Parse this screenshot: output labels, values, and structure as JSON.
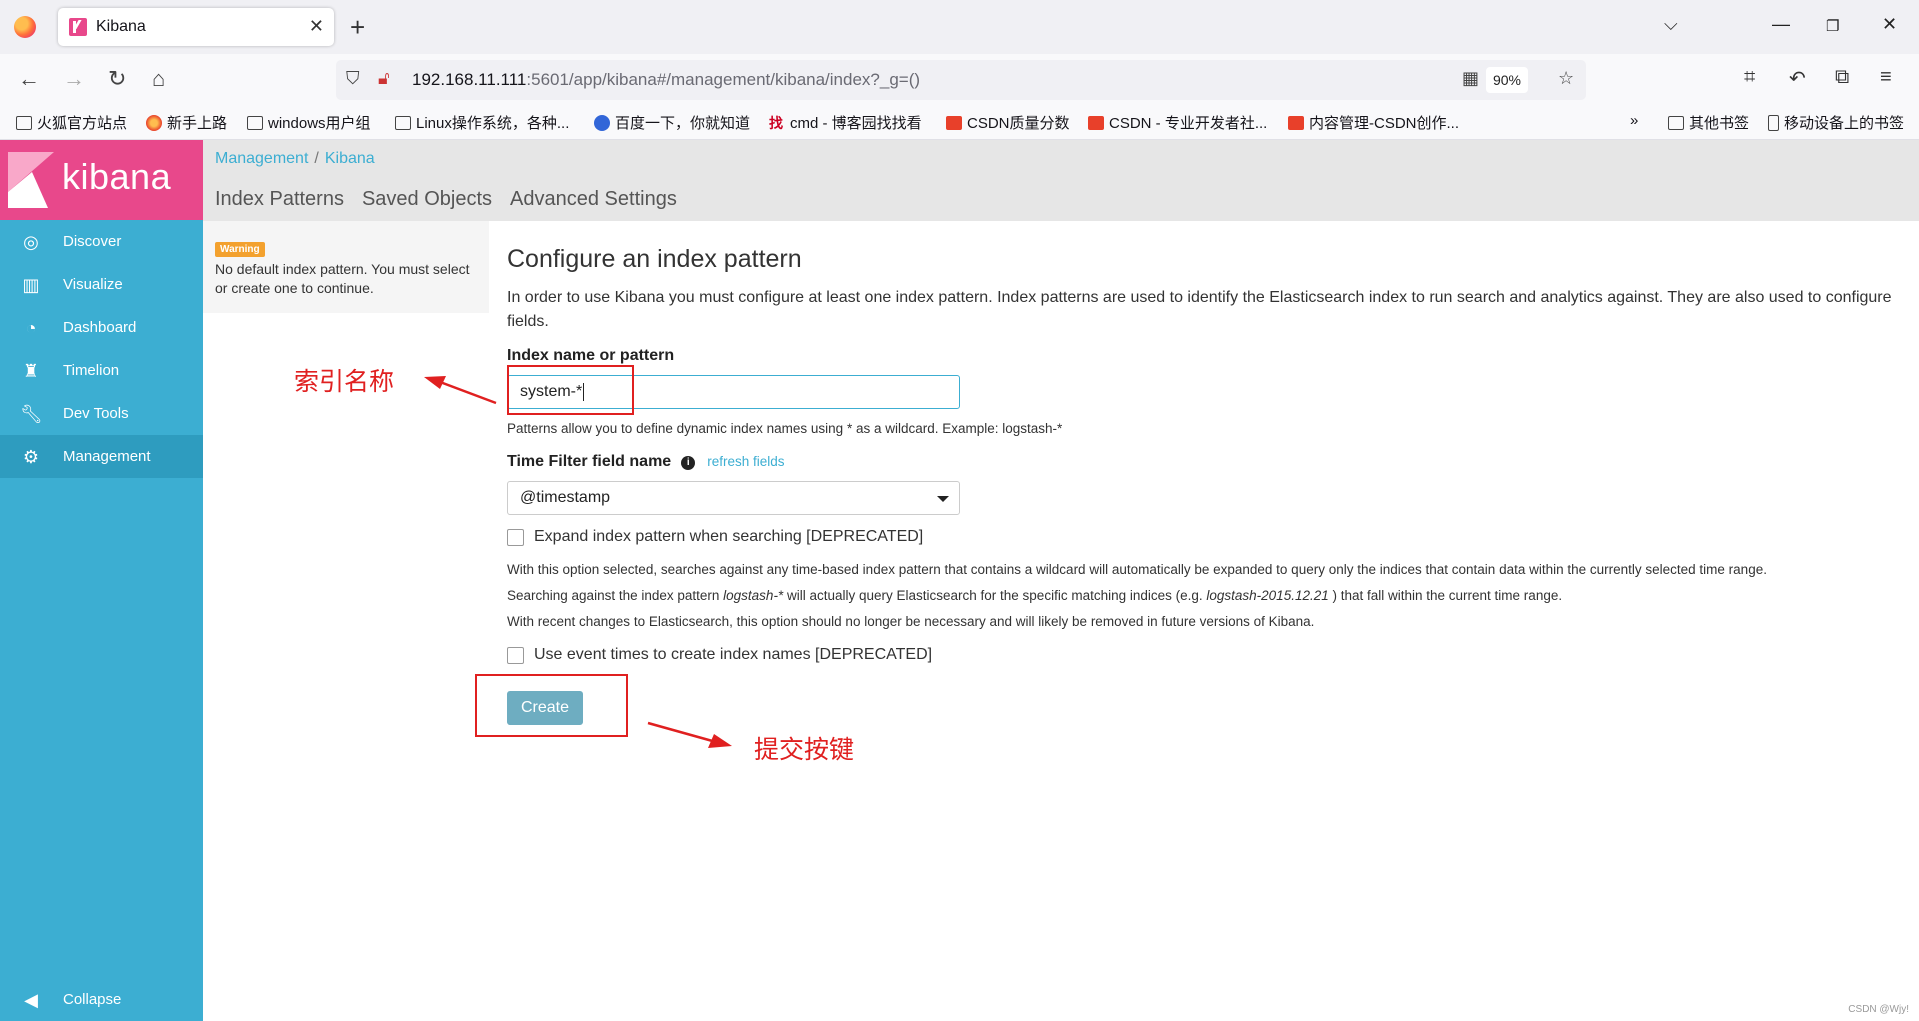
{
  "browser": {
    "tab_title": "Kibana",
    "url_host": "192.168.11.111",
    "url_rest": ":5601/app/kibana#/management/kibana/index?_g=()",
    "zoom": "90%",
    "bookmarks": [
      "火狐官方站点",
      "新手上路",
      "windows用户组",
      "Linux操作系统，各种...",
      "百度一下，你就知道",
      "cmd - 博客园找找看",
      "CSDN质量分数",
      "CSDN - 专业开发者社...",
      "内容管理-CSDN创作..."
    ],
    "bookmarks_right": [
      "其他书签",
      "移动设备上的书签"
    ]
  },
  "sidebar": {
    "logo": "kibana",
    "items": [
      {
        "label": "Discover",
        "icon": "compass-icon"
      },
      {
        "label": "Visualize",
        "icon": "bar-chart-icon"
      },
      {
        "label": "Dashboard",
        "icon": "gauge-icon"
      },
      {
        "label": "Timelion",
        "icon": "timelion-icon"
      },
      {
        "label": "Dev Tools",
        "icon": "wrench-icon"
      },
      {
        "label": "Management",
        "icon": "gear-icon"
      }
    ],
    "collapse": "Collapse"
  },
  "header": {
    "breadcrumb": [
      "Management",
      "Kibana"
    ],
    "tabs": [
      "Index Patterns",
      "Saved Objects",
      "Advanced Settings"
    ]
  },
  "warning": {
    "badge": "Warning",
    "text": "No default index pattern. You must select or create one to continue."
  },
  "main": {
    "title": "Configure an index pattern",
    "intro": "In order to use Kibana you must configure at least one index pattern. Index patterns are used to identify the Elasticsearch index to run search and analytics against. They are also used to configure fields.",
    "index_label": "Index name or pattern",
    "index_value": "system-*",
    "index_help": "Patterns allow you to define dynamic index names using * as a wildcard. Example: logstash-*",
    "time_label": "Time Filter field name",
    "refresh": "refresh fields",
    "time_value": "@timestamp",
    "expand_label": "Expand index pattern when searching [DEPRECATED]",
    "expand_note_1": "With this option selected, searches against any time-based index pattern that contains a wildcard will automatically be expanded to query only the indices that contain data within the currently selected time range.",
    "expand_note_2a": "Searching against the index pattern ",
    "expand_note_2b": "logstash-*",
    "expand_note_2c": " will actually query Elasticsearch for the specific matching indices (e.g. ",
    "expand_note_2d": "logstash-2015.12.21",
    "expand_note_2e": " ) that fall within the current time range.",
    "expand_note_3": "With recent changes to Elasticsearch, this option should no longer be necessary and will likely be removed in future versions of Kibana.",
    "event_label": "Use event times to create index names [DEPRECATED]",
    "create": "Create"
  },
  "annotations": {
    "index_note": "索引名称",
    "submit_note": "提交按键",
    "color": "#e02020"
  },
  "watermark": "CSDN @Wjy!"
}
